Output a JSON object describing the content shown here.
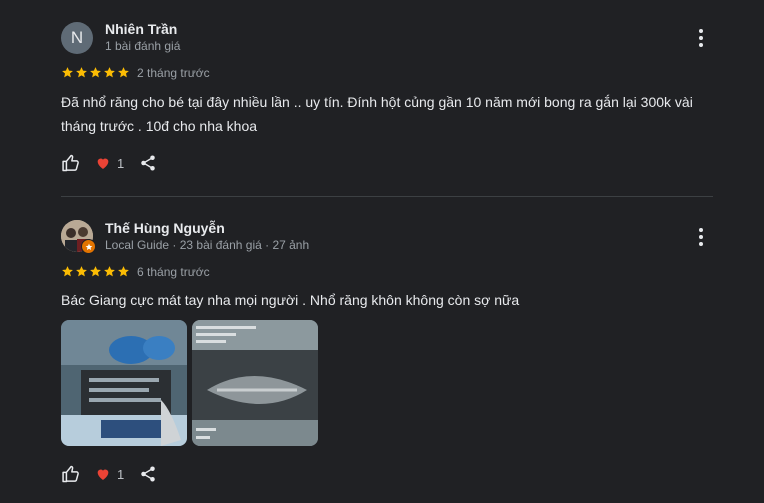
{
  "reviews": [
    {
      "avatar_letter": "N",
      "name": "Nhiên Trần",
      "meta": "1 bài đánh giá",
      "rating": 5,
      "time": "2 tháng trước",
      "text": "Đã nhổ răng cho bé tại đây nhiều lần .. uy tín. Đính hột củng gần 10 năm mới bong ra gắn lại 300k vài tháng trước . 10đ cho nha khoa",
      "likes": "1"
    },
    {
      "name": "Thế Hùng Nguyễn",
      "meta": "Local Guide · 23 bài đánh giá · 27 ảnh",
      "rating": 5,
      "time": "6 tháng trước",
      "text": "Bác Giang cực mát tay nha mọi người . Nhổ răng khôn không còn sợ nữa ",
      "likes": "1"
    }
  ],
  "icons": {
    "like": "thumb-up-outline-icon",
    "heart": "heart-icon",
    "share": "share-icon",
    "more": "more-vertical-icon",
    "star": "star-icon"
  },
  "colors": {
    "background": "#202124",
    "star": "#fbbc04",
    "heart": "#ea4335",
    "muted": "#9aa0a6"
  }
}
